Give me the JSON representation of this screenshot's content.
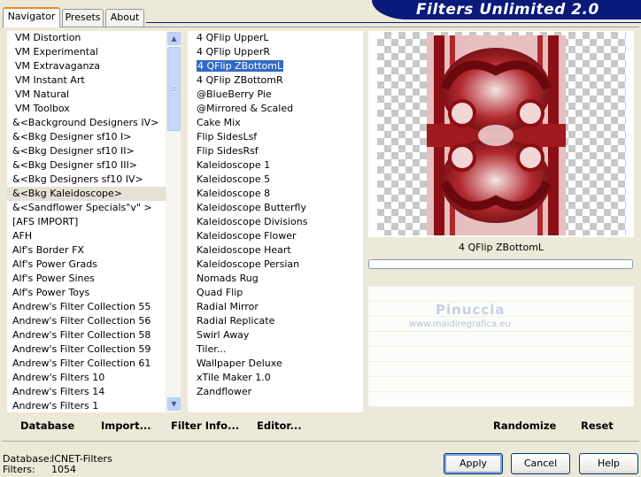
{
  "app": {
    "title": "Filters Unlimited 2.0"
  },
  "tabs": [
    {
      "label": "Navigator",
      "active": true
    },
    {
      "label": "Presets",
      "active": false
    },
    {
      "label": "About",
      "active": false
    }
  ],
  "categories": {
    "items": [
      "VM Distortion",
      "VM Experimental",
      "VM Extravaganza",
      "VM Instant Art",
      "VM Natural",
      "VM Toolbox",
      "&<Background Designers IV>",
      "&<Bkg Designer sf10 I>",
      "&<Bkg Designer sf10 II>",
      "&<Bkg Designer sf10 III>",
      "&<Bkg Designers sf10 IV>",
      "&<Bkg Kaleidoscope>",
      "&<Sandflower Specials\"v\" >",
      "[AFS IMPORT]",
      "AFH",
      "Alf's Border FX",
      "Alf's Power Grads",
      "Alf's Power Sines",
      "Alf's Power Toys",
      "Andrew's Filter Collection 55",
      "Andrew's Filter Collection 56",
      "Andrew's Filter Collection 58",
      "Andrew's Filter Collection 59",
      "Andrew's Filter Collection 61",
      "Andrew's Filters 10",
      "Andrew's Filters 14",
      "Andrew's Filters 1"
    ],
    "selected_index": 11
  },
  "filters": {
    "items": [
      "4 QFlip UpperL",
      "4 QFlip UpperR",
      "4 QFlip ZBottomL",
      "4 QFlip ZBottomR",
      "@BlueBerry Pie",
      "@Mirrored & Scaled",
      "Cake Mix",
      "Flip SidesLsf",
      "Flip SidesRsf",
      "Kaleidoscope 1",
      "Kaleidoscope 5",
      "Kaleidoscope 8",
      "Kaleidoscope Butterfly",
      "Kaleidoscope Divisions",
      "Kaleidoscope Flower",
      "Kaleidoscope Heart",
      "Kaleidoscope Persian",
      "Nomads Rug",
      "Quad Flip",
      "Radial Mirror",
      "Radial Replicate",
      "Swirl Away",
      "Tiler...",
      "Wallpaper Deluxe",
      "xTile Maker 1.0",
      "Zandflower"
    ],
    "selected_index": 2
  },
  "preview": {
    "filter_name": "4 QFlip ZBottomL",
    "progress": 0,
    "watermark": "Pinuccia",
    "watermark_url": "www.maidiregrafica.eu",
    "colors": {
      "dark_red": "#8b0f14",
      "mid_red": "#b0282e",
      "light_red": "#e8bfc0",
      "pale": "#f6e4e4"
    }
  },
  "toolbar": {
    "database": "Database",
    "import": "Import...",
    "filter_info": "Filter Info...",
    "editor": "Editor...",
    "randomize": "Randomize",
    "reset": "Reset"
  },
  "status": {
    "database_label": "Database:",
    "database_value": "ICNET-Filters",
    "filters_label": "Filters:",
    "filters_value": "1054"
  },
  "buttons": {
    "apply": "Apply",
    "cancel": "Cancel",
    "help": "Help"
  }
}
